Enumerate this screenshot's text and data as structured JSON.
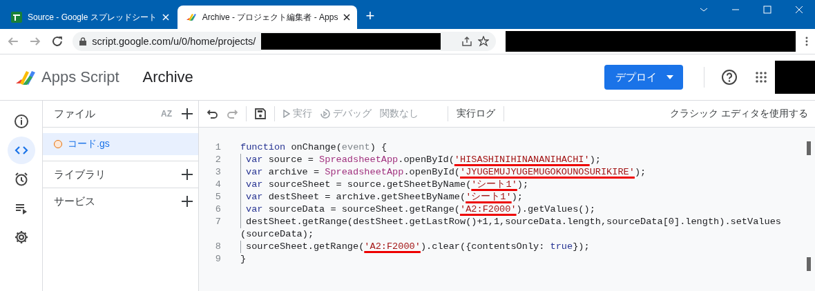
{
  "browser": {
    "tabs": [
      {
        "title": "Source - Google スプレッドシート",
        "selected": false
      },
      {
        "title": "Archive - プロジェクト編集者 - Apps",
        "selected": true
      }
    ],
    "new_tab": "+",
    "address": "script.google.com/u/0/home/projects/"
  },
  "header": {
    "product": "Apps Script",
    "project": "Archive",
    "deploy": "デプロイ"
  },
  "rail": [
    {
      "selected": false
    },
    {
      "selected": true
    },
    {
      "selected": false
    },
    {
      "selected": false
    },
    {
      "selected": false
    }
  ],
  "files": {
    "title": "ファイル",
    "sort": "AZ",
    "items": [
      {
        "name": "コード.gs",
        "selected": true
      }
    ],
    "sections": [
      "ライブラリ",
      "サービス"
    ]
  },
  "toolbar": {
    "run": {
      "label": "実行",
      "disabled": true
    },
    "debug": {
      "label": "デバッグ",
      "disabled": true
    },
    "function": "関数なし",
    "log": "実行ログ",
    "classic": "クラシック エディタを使用する"
  },
  "code": [
    {
      "number": "1",
      "indented": false,
      "tokens": [
        {
          "kind": "keyword",
          "text": "function"
        },
        {
          "kind": "plain",
          "text": " onChange("
        },
        {
          "kind": "muted",
          "text": "event"
        },
        {
          "kind": "plain",
          "text": ") {"
        }
      ]
    },
    {
      "number": "2",
      "indented": true,
      "tokens": [
        {
          "kind": "keyword",
          "text": "var"
        },
        {
          "kind": "plain",
          "text": " source = "
        },
        {
          "kind": "type",
          "text": "SpreadsheetApp"
        },
        {
          "kind": "plain",
          "text": ".openById("
        },
        {
          "kind": "marked-string",
          "text": "'HISASHINIHINANANIHACHI'"
        },
        {
          "kind": "plain",
          "text": ");"
        }
      ]
    },
    {
      "number": "3",
      "indented": true,
      "tokens": [
        {
          "kind": "keyword",
          "text": "var"
        },
        {
          "kind": "plain",
          "text": " archive = "
        },
        {
          "kind": "type",
          "text": "SpreadsheetApp"
        },
        {
          "kind": "plain",
          "text": ".openById("
        },
        {
          "kind": "marked-string",
          "text": "'JYUGEMUJYUGEMUGOKOUNOSURIKIRE'"
        },
        {
          "kind": "plain",
          "text": ");"
        }
      ]
    },
    {
      "number": "4",
      "indented": true,
      "tokens": [
        {
          "kind": "keyword",
          "text": "var"
        },
        {
          "kind": "plain",
          "text": " sourceSheet = source.getSheetByName("
        },
        {
          "kind": "marked-string",
          "text": "'シート1'"
        },
        {
          "kind": "plain",
          "text": ");"
        }
      ]
    },
    {
      "number": "5",
      "indented": true,
      "tokens": [
        {
          "kind": "keyword",
          "text": "var"
        },
        {
          "kind": "plain",
          "text": " destSheet = archive.getSheetByName("
        },
        {
          "kind": "marked-string",
          "text": "'シート1'"
        },
        {
          "kind": "plain",
          "text": ");"
        }
      ]
    },
    {
      "number": "6",
      "indented": true,
      "tokens": [
        {
          "kind": "keyword",
          "text": "var"
        },
        {
          "kind": "plain",
          "text": " sourceData = sourceSheet.getRange("
        },
        {
          "kind": "marked-string",
          "text": "'A2:F2000'"
        },
        {
          "kind": "plain",
          "text": ").getValues();"
        }
      ]
    },
    {
      "number": "7",
      "indented": true,
      "tokens": [
        {
          "kind": "plain",
          "text": "destSheet.getRange(destSheet.getLastRow()+1,1,sourceData.length,sourceData[0].length).setValues"
        }
      ],
      "continuation": "(sourceData);"
    },
    {
      "number": "8",
      "indented": true,
      "tokens": [
        {
          "kind": "plain",
          "text": "sourceSheet.getRange("
        },
        {
          "kind": "marked-string",
          "text": "'A2:F2000'"
        },
        {
          "kind": "plain",
          "text": ").clear({contentsOnly: "
        },
        {
          "kind": "keyword",
          "text": "true"
        },
        {
          "kind": "plain",
          "text": "});"
        }
      ]
    },
    {
      "number": "9",
      "indented": false,
      "tokens": [
        {
          "kind": "plain",
          "text": "}"
        }
      ]
    }
  ]
}
